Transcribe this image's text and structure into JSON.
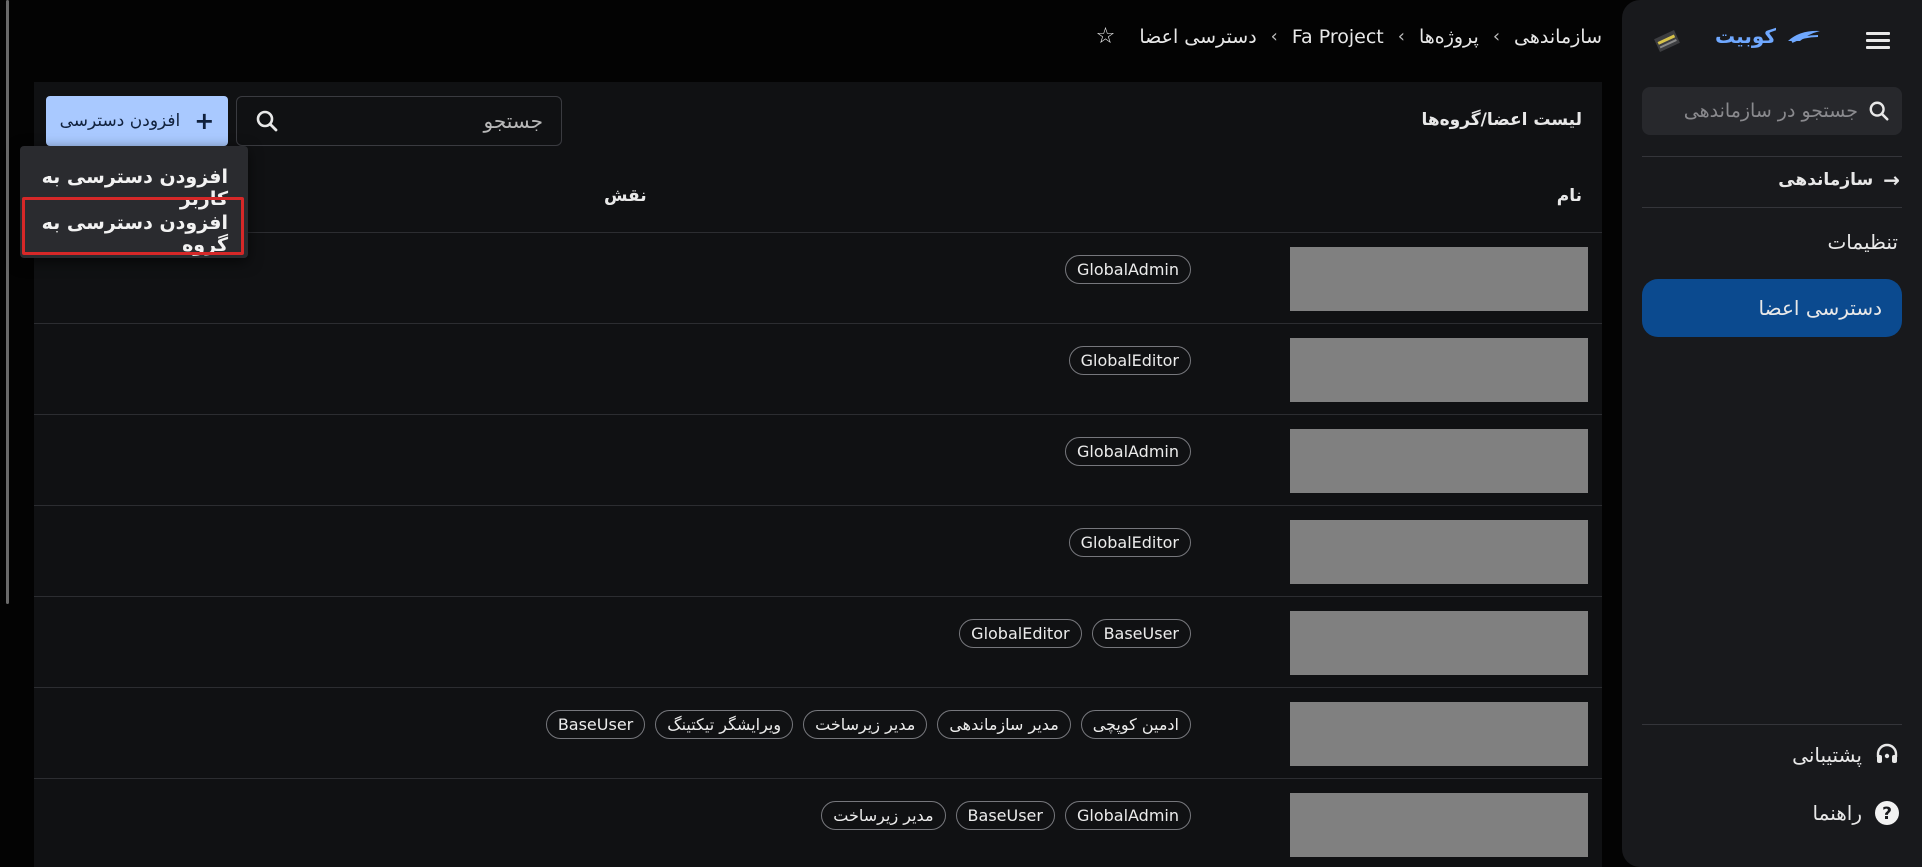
{
  "breadcrumb": {
    "items": [
      "سازماندهی",
      "پروژه‌ها",
      "Fa Project",
      "دسترسی اعضا"
    ]
  },
  "sidebar": {
    "brand": "کوبیت",
    "search_placeholder": "جستجو در سازماندهی",
    "org_label": "سازماندهی",
    "settings_label": "تنظیمات",
    "active_label": "دسترسی اعضا",
    "support_label": "پشتیبانی",
    "help_label": "راهنما"
  },
  "main": {
    "title": "لیست اعضا/گروه‌ها",
    "search_placeholder": "جستجو",
    "add_button": "افزودن دسترسی",
    "col_name": "نام",
    "col_role": "نقش"
  },
  "dropdown": {
    "items": [
      "افزودن دسترسی به کاربر",
      "افزودن دسترسی به گروه"
    ]
  },
  "rows": [
    {
      "roles": [
        "GlobalAdmin"
      ]
    },
    {
      "roles": [
        "GlobalEditor"
      ]
    },
    {
      "roles": [
        "GlobalAdmin"
      ]
    },
    {
      "roles": [
        "GlobalEditor"
      ]
    },
    {
      "roles": [
        "BaseUser",
        "GlobalEditor"
      ]
    },
    {
      "roles": [
        "ادمین کوپچی",
        "مدیر سازماندهی",
        "مدیر زیرساخت",
        "ویرایشگر تیکتینگ",
        "BaseUser"
      ]
    },
    {
      "roles": [
        "GlobalAdmin",
        "BaseUser",
        "مدیر زیرساخت"
      ]
    }
  ],
  "colors": {
    "accent_button": "#a9c9ff",
    "sidebar_active": "#0b4a8f",
    "brand": "#6fa8ff",
    "highlight": "#d62828"
  }
}
